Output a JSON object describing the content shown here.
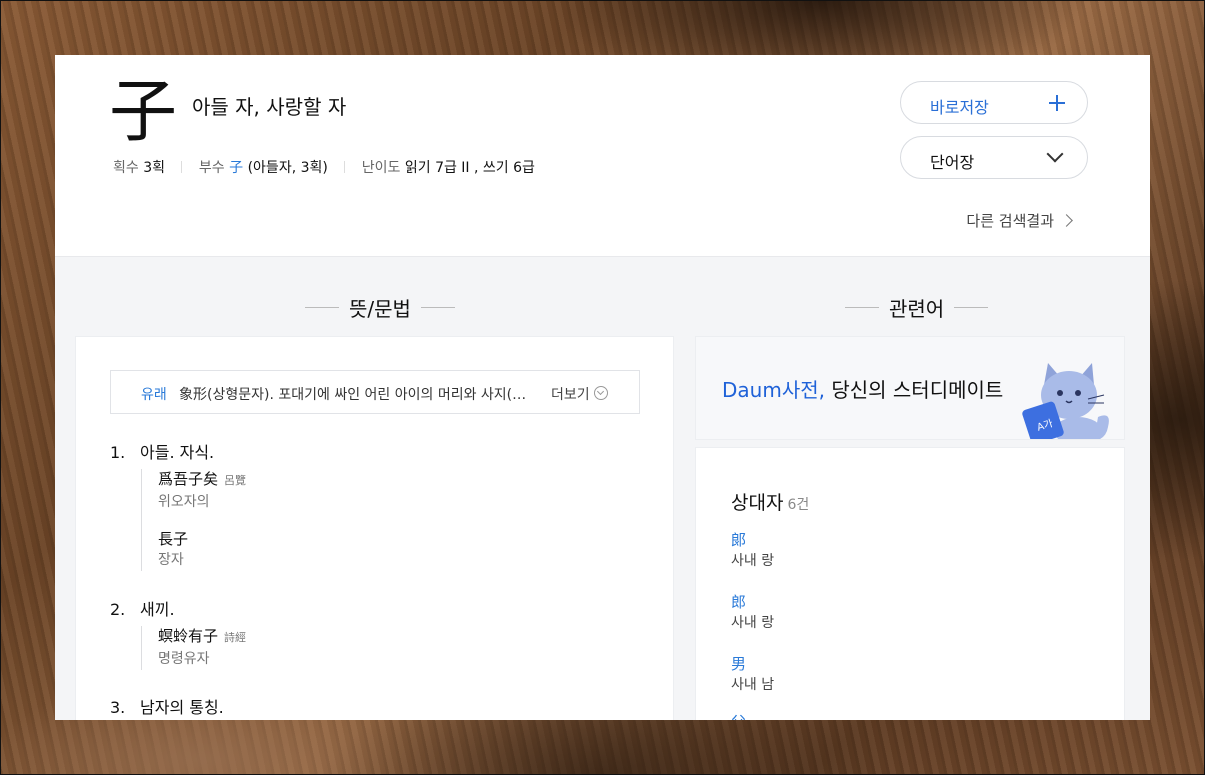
{
  "entry": {
    "character": "子",
    "meaning": "아들 자, 사랑할 자",
    "strokes_label": "획수",
    "strokes_value": "3획",
    "radical_label": "부수",
    "radical_char": "子",
    "radical_desc": "(아들자, 3획)",
    "difficulty_label": "난이도",
    "difficulty_value": "읽기 7급 II , 쓰기 6급"
  },
  "actions": {
    "save_label": "바로저장",
    "wordbook_label": "단어장",
    "other_results": "다른 검색결과"
  },
  "sections": {
    "meaning_grammar": "뜻/문법",
    "related": "관련어"
  },
  "origin": {
    "label": "유래",
    "text": "象形(상형문자). 포대기에 싸인 어린 아이의 머리와 사지(팔과 다리)를 본뜬 글자.",
    "more_label": "더보기"
  },
  "definitions": [
    {
      "num": "1.",
      "text": "아들. 자식.",
      "examples": [
        {
          "hanja": "爲吾子矣",
          "source": "呂覽",
          "korean": "위오자의"
        },
        {
          "hanja": "長子",
          "source": "",
          "korean": "장자"
        }
      ]
    },
    {
      "num": "2.",
      "text": "새끼.",
      "examples": [
        {
          "hanja": "螟蛉有子",
          "source": "詩經",
          "korean": "명령유자"
        }
      ]
    },
    {
      "num": "3.",
      "text": "남자의 통칭.",
      "examples": []
    }
  ],
  "banner": {
    "brand": "Daum사전,",
    "slogan": " 당신의 스터디메이트"
  },
  "antonyms": {
    "title": "상대자",
    "count": "6건",
    "items": [
      {
        "hanja": "郞",
        "reading": "사내 랑"
      },
      {
        "hanja": "郎",
        "reading": "사내 랑"
      },
      {
        "hanja": "男",
        "reading": "사내 남"
      },
      {
        "hanja": "父",
        "reading": ""
      }
    ]
  }
}
